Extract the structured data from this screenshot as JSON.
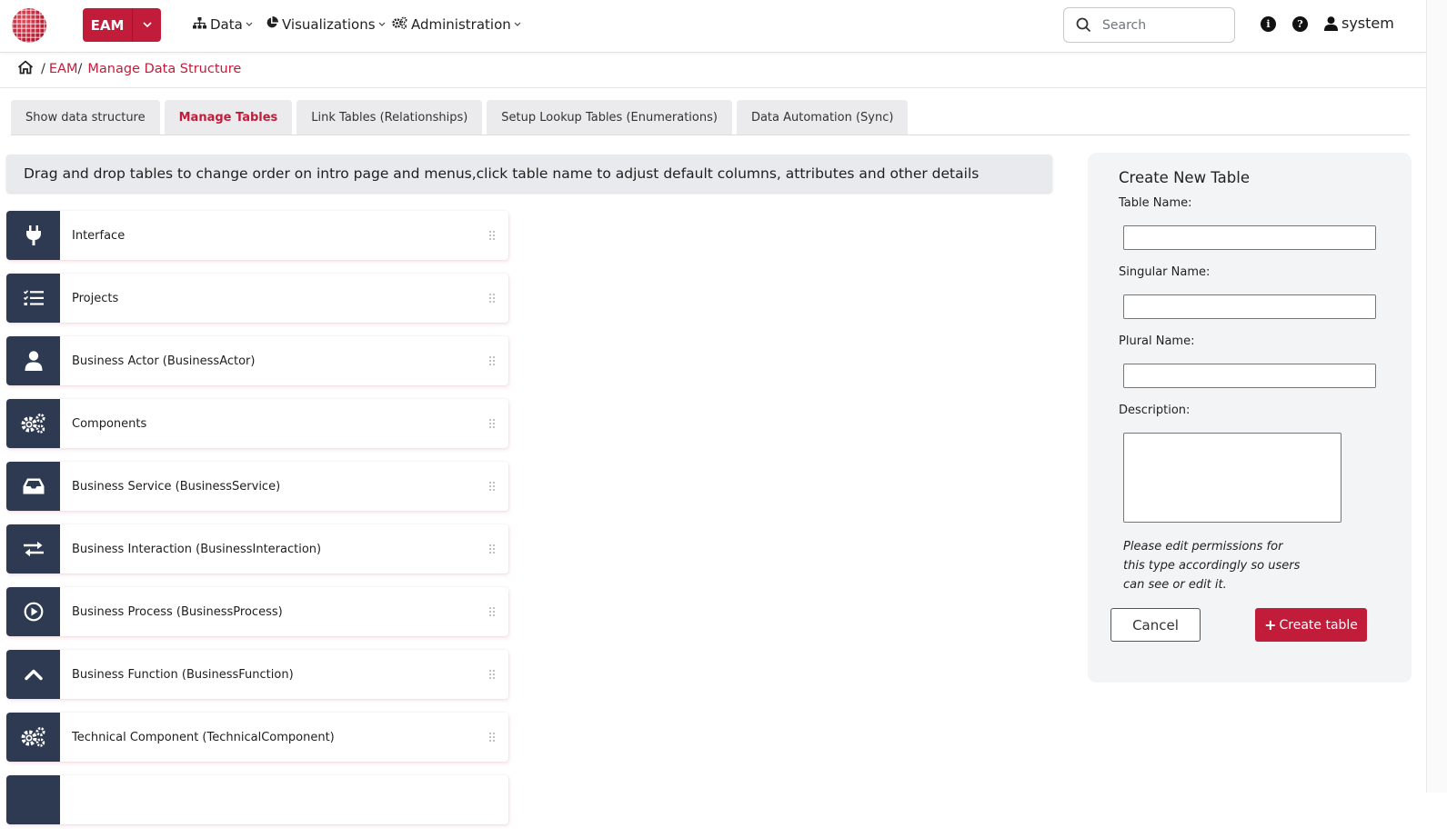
{
  "app": {
    "brand_button": "EAM",
    "brand_color": "#c11d3b"
  },
  "nav": {
    "menus": [
      {
        "label": "Data",
        "icon": "sitemap-icon"
      },
      {
        "label": "Visualizations",
        "icon": "pie-chart-icon"
      },
      {
        "label": "Administration",
        "icon": "cogs-icon"
      }
    ],
    "search_placeholder": "Search",
    "user_name": "system"
  },
  "breadcrumb": {
    "home_icon": "home-icon",
    "items": [
      "EAM",
      "Manage Data Structure"
    ]
  },
  "tabs": [
    {
      "label": "Show data structure",
      "active": false
    },
    {
      "label": "Manage Tables",
      "active": true
    },
    {
      "label": "Link Tables (Relationships)",
      "active": false
    },
    {
      "label": "Setup Lookup Tables (Enumerations)",
      "active": false
    },
    {
      "label": "Data Automation (Sync)",
      "active": false
    }
  ],
  "info_text": "Drag and drop tables to change order on intro page and menus,click table name to adjust default columns, attributes and other details",
  "tables": [
    {
      "name": "Interface",
      "icon": "plug-icon"
    },
    {
      "name": "Projects",
      "icon": "tasks-icon"
    },
    {
      "name": "Business Actor (BusinessActor)",
      "icon": "user-icon"
    },
    {
      "name": "Components",
      "icon": "cogs-icon"
    },
    {
      "name": "Business Service (BusinessService)",
      "icon": "inbox-icon"
    },
    {
      "name": "Business Interaction (BusinessInteraction)",
      "icon": "exchange-icon"
    },
    {
      "name": "Business Process (BusinessProcess)",
      "icon": "play-circle-icon"
    },
    {
      "name": "Business Function (BusinessFunction)",
      "icon": "chevron-up-icon"
    },
    {
      "name": "Technical Component (TechnicalComponent)",
      "icon": "cogs-icon"
    }
  ],
  "create_panel": {
    "title": "Create New Table",
    "table_name_label": "Table Name:",
    "singular_name_label": "Singular Name:",
    "plural_name_label": "Plural Name:",
    "description_label": "Description:",
    "note": "Please edit permissions for this type accordingly so users can see or edit it.",
    "cancel_label": "Cancel",
    "create_label": "Create table"
  }
}
